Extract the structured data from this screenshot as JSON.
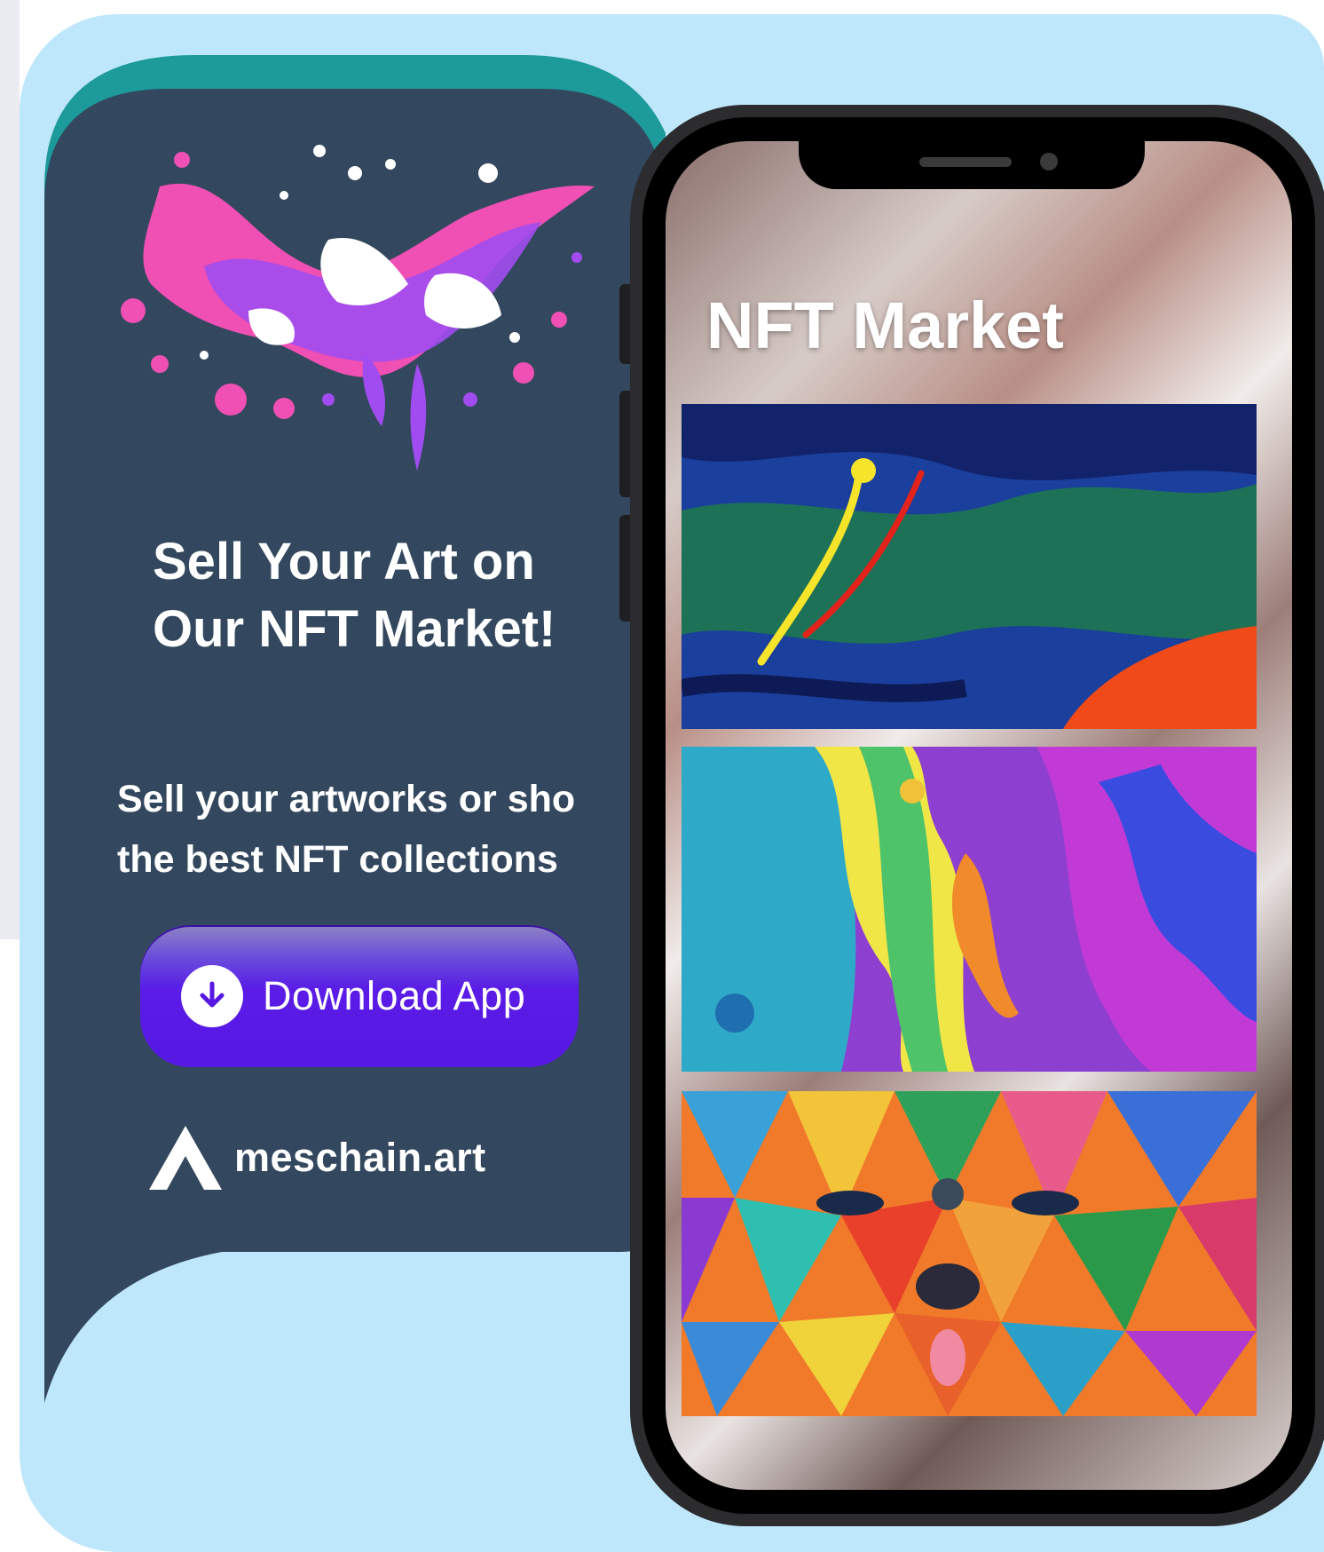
{
  "promo": {
    "headline": "Sell Your Art on Our NFT Market!",
    "subline_line1": "Sell your artworks or sho",
    "subline_line2": "the best NFT collections",
    "download_label": "Download App"
  },
  "brand": {
    "name": "meschain.art"
  },
  "phone": {
    "screen_title": "NFT Market"
  },
  "colors": {
    "panel": "#33485e",
    "teal": "#1d9a9a",
    "background": "#bfe7fb",
    "button": "#5617e2"
  }
}
